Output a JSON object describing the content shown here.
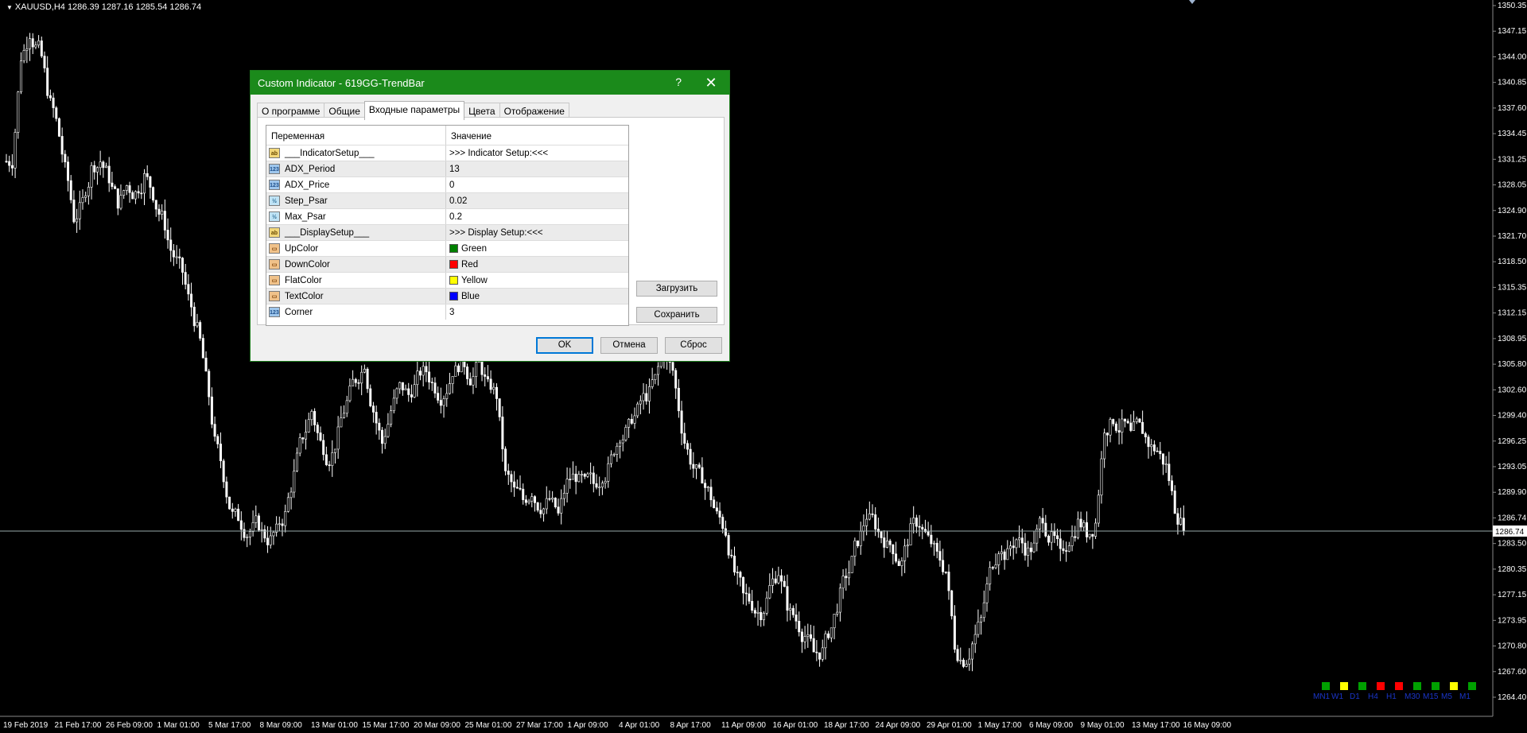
{
  "chart": {
    "header": "XAUUSD,H4  1286.39 1287.16 1285.54 1286.74",
    "current_price": "1286.74",
    "price_ticks": [
      "1350.35",
      "1347.15",
      "1344.00",
      "1340.85",
      "1337.60",
      "1334.45",
      "1331.25",
      "1328.05",
      "1324.90",
      "1321.70",
      "1318.50",
      "1315.35",
      "1312.15",
      "1308.95",
      "1305.80",
      "1302.60",
      "1299.40",
      "1296.25",
      "1293.05",
      "1289.90",
      "1286.74",
      "1283.50",
      "1280.35",
      "1277.15",
      "1273.95",
      "1270.80",
      "1267.60",
      "1264.40"
    ],
    "time_ticks": [
      "19 Feb 2019",
      "21 Feb 17:00",
      "26 Feb 09:00",
      "1 Mar 01:00",
      "5 Mar 17:00",
      "8 Mar 09:00",
      "13 Mar 01:00",
      "15 Mar 17:00",
      "20 Mar 09:00",
      "25 Mar 01:00",
      "27 Mar 17:00",
      "1 Apr 09:00",
      "4 Apr 01:00",
      "8 Apr 17:00",
      "11 Apr 09:00",
      "16 Apr 01:00",
      "18 Apr 17:00",
      "24 Apr 09:00",
      "29 Apr 01:00",
      "1 May 17:00",
      "6 May 09:00",
      "9 May 01:00",
      "13 May 17:00",
      "16 May 09:00"
    ],
    "series": {
      "price_min": 1264.4,
      "price_max": 1350.35,
      "close": [
        1331,
        1344,
        1347,
        1345,
        1340,
        1336,
        1330,
        1324,
        1326,
        1330,
        1331,
        1329,
        1326,
        1328,
        1327,
        1329,
        1327,
        1324,
        1320,
        1318,
        1314,
        1310,
        1304,
        1296,
        1292,
        1287,
        1286,
        1285,
        1286,
        1284,
        1285,
        1287,
        1292,
        1297,
        1300,
        1296,
        1294,
        1297,
        1301,
        1304,
        1306,
        1300,
        1296,
        1300,
        1303,
        1302,
        1304,
        1305,
        1303,
        1302,
        1305,
        1306,
        1304,
        1306,
        1303,
        1302,
        1292,
        1290,
        1289,
        1290,
        1288,
        1289,
        1287,
        1291,
        1292,
        1291,
        1291,
        1292,
        1294,
        1297,
        1298,
        1300,
        1302,
        1304,
        1307,
        1305,
        1298,
        1294,
        1292,
        1290,
        1287,
        1285,
        1280,
        1277,
        1276,
        1275,
        1278,
        1280,
        1276,
        1274,
        1272,
        1270,
        1270,
        1273,
        1277,
        1280,
        1284,
        1287,
        1286,
        1284,
        1283,
        1281,
        1285,
        1286,
        1284,
        1282,
        1280,
        1271,
        1269,
        1271,
        1274,
        1280,
        1283,
        1282,
        1284,
        1283,
        1283,
        1287,
        1284,
        1282,
        1284,
        1286,
        1285,
        1286,
        1298,
        1299,
        1298,
        1297,
        1298,
        1296,
        1295,
        1293,
        1288,
        1286
      ]
    },
    "timeframes": [
      {
        "label": "MN1",
        "color": "#00a000"
      },
      {
        "label": "W1",
        "color": "#ffff00"
      },
      {
        "label": "D1",
        "color": "#00a000"
      },
      {
        "label": "H4",
        "color": "#ff0000"
      },
      {
        "label": "H1",
        "color": "#ff0000"
      },
      {
        "label": "M30",
        "color": "#00a000"
      },
      {
        "label": "M15",
        "color": "#00a000"
      },
      {
        "label": "M5",
        "color": "#ffff00"
      },
      {
        "label": "M1",
        "color": "#00a000"
      }
    ]
  },
  "dialog": {
    "title": "Custom Indicator - 619GG-TrendBar",
    "help": "?",
    "close": "✕",
    "tabs": [
      "О программе",
      "Общие",
      "Входные параметры",
      "Цвета",
      "Отображение"
    ],
    "active_tab": 2,
    "columns": [
      "Переменная",
      "Значение"
    ],
    "params": [
      {
        "icon": "ab",
        "name": "___IndicatorSetup___",
        "value": ">>> Indicator Setup:<<<"
      },
      {
        "icon": "123",
        "name": "ADX_Period",
        "value": "13"
      },
      {
        "icon": "123",
        "name": "ADX_Price",
        "value": "0"
      },
      {
        "icon": "1/2",
        "name": "Step_Psar",
        "value": "0.02"
      },
      {
        "icon": "1/2",
        "name": "Max_Psar",
        "value": "0.2"
      },
      {
        "icon": "ab",
        "name": "___DisplaySetup___",
        "value": ">>> Display Setup:<<<"
      },
      {
        "icon": "color",
        "name": "UpColor",
        "value": "Green",
        "swatch": "#008000"
      },
      {
        "icon": "color",
        "name": "DownColor",
        "value": "Red",
        "swatch": "#ff0000"
      },
      {
        "icon": "color",
        "name": "FlatColor",
        "value": "Yellow",
        "swatch": "#ffff00"
      },
      {
        "icon": "color",
        "name": "TextColor",
        "value": "Blue",
        "swatch": "#0000ff"
      },
      {
        "icon": "123",
        "name": "Corner",
        "value": "3"
      }
    ],
    "load_button": "Загрузить",
    "save_button": "Сохранить",
    "ok_button": "OK",
    "cancel_button": "Отмена",
    "reset_button": "Сброс"
  }
}
